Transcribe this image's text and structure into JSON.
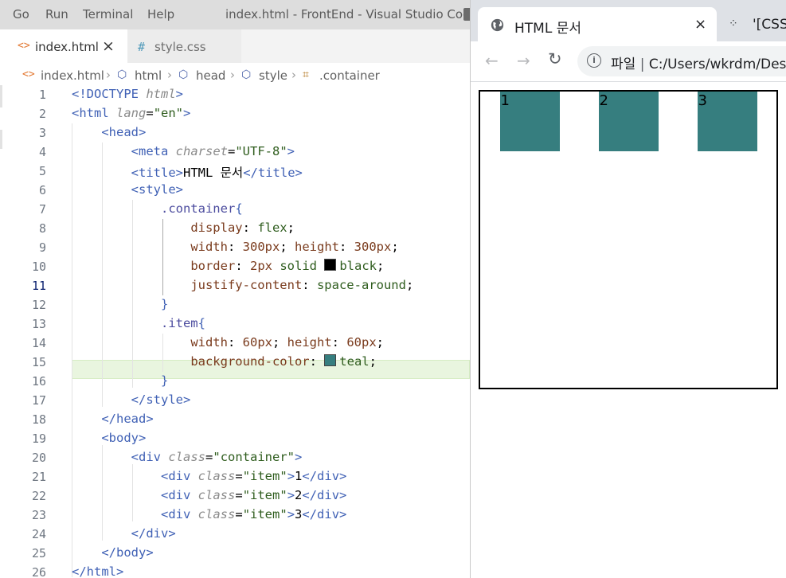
{
  "menubar": {
    "items": [
      "Go",
      "Run",
      "Terminal",
      "Help"
    ],
    "window_title": "index.html - FrontEnd - Visual Studio Code"
  },
  "editor_tabs": [
    {
      "icon": "<>",
      "label": "index.html",
      "close": "×",
      "active": true
    },
    {
      "icon": "#",
      "label": "style.css",
      "active": false
    }
  ],
  "breadcrumb": [
    {
      "icon": "<>",
      "label": "index.html"
    },
    {
      "icon": "cube",
      "label": "html"
    },
    {
      "icon": "cube",
      "label": "head"
    },
    {
      "icon": "cube",
      "label": "style"
    },
    {
      "icon": "selector",
      "label": ".container"
    }
  ],
  "code": {
    "line_numbers": [
      "1",
      "2",
      "3",
      "4",
      "5",
      "6",
      "7",
      "8",
      "9",
      "10",
      "11",
      "12",
      "13",
      "14",
      "15",
      "16",
      "17",
      "18",
      "19",
      "20",
      "21",
      "22",
      "23",
      "24",
      "25",
      "26"
    ],
    "active_line": "11",
    "css_colors": {
      "black": "#000000",
      "teal": "#367e7f"
    },
    "text": {
      "doctype": "DOCTYPE",
      "doctype_html": "html",
      "html_tag": "html",
      "lang_attr": "lang",
      "lang_val": "\"en\"",
      "head_tag": "head",
      "meta_tag": "meta",
      "charset_attr": "charset",
      "charset_val": "\"UTF-8\"",
      "title_tag": "title",
      "title_text": "HTML 문서",
      "style_tag": "style",
      "container_sel": ".container",
      "display_prop": "display",
      "display_val": "flex",
      "width_prop": "width",
      "width_val": "300px",
      "height_prop": "height",
      "height_val": "300px",
      "border_prop": "border",
      "border_val_1": "2px",
      "border_val_2": "solid",
      "border_val_3": "black",
      "justify_prop": "justify-content",
      "justify_val": "space-around",
      "item_sel": ".item",
      "item_width_val": "60px",
      "item_height_val": "60px",
      "bg_prop": "background-color",
      "bg_val": "teal",
      "body_tag": "body",
      "div_tag": "div",
      "class_attr": "class",
      "container_val": "\"container\"",
      "item_val": "\"item\"",
      "item1": "1",
      "item2": "2",
      "item3": "3"
    }
  },
  "browser": {
    "tab_title": "HTML 문서",
    "tab_close": "×",
    "next_tab_title": "'[CSS]",
    "address_label": "파일",
    "address_sep": "|",
    "address_url": "C:/Users/wkrdm/Des",
    "demo_items": [
      "1",
      "2",
      "3"
    ],
    "item_color": "#367e7f"
  }
}
